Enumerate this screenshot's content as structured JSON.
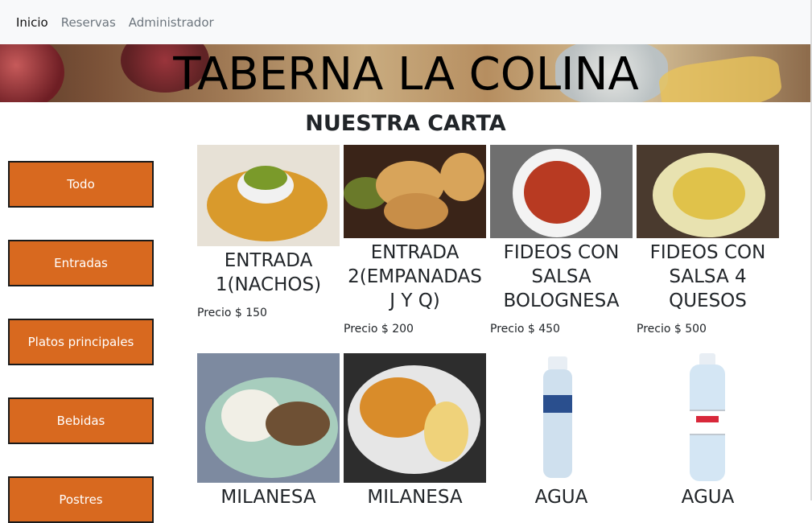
{
  "nav": {
    "items": [
      "Inicio",
      "Reservas",
      "Administrador"
    ]
  },
  "banner": {
    "title": "TABERNA LA COLINA"
  },
  "menu": {
    "title": "NUESTRA CARTA"
  },
  "categories": [
    "Todo",
    "Entradas",
    "Platos principales",
    "Bebidas",
    "Postres"
  ],
  "products": [
    {
      "name": "ENTRADA 1(NACHOS)",
      "price": "Precio $ 150"
    },
    {
      "name": "ENTRADA 2(EMPANADAS J Y Q)",
      "price": "Precio $ 200"
    },
    {
      "name": "FIDEOS CON SALSA BOLOGNESA",
      "price": "Precio $ 450"
    },
    {
      "name": "FIDEOS CON SALSA 4 QUESOS",
      "price": "Precio $ 500"
    },
    {
      "name": "MILANESA",
      "price": ""
    },
    {
      "name": "MILANESA",
      "price": ""
    },
    {
      "name": "AGUA",
      "price": ""
    },
    {
      "name": "AGUA",
      "price": ""
    }
  ],
  "colors": {
    "category_button": "#d8691f",
    "navbar": "#f8f9fa"
  }
}
